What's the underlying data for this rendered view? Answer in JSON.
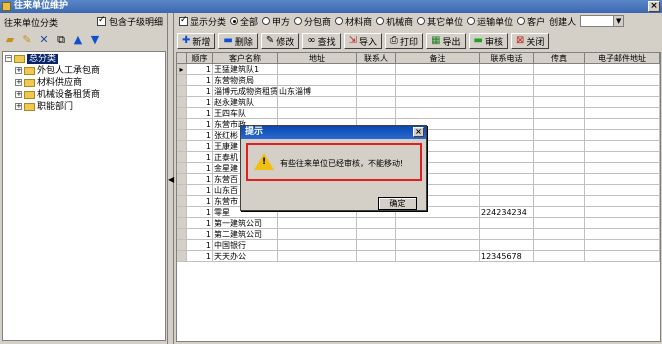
{
  "window": {
    "title": "往来单位维护",
    "close": "×"
  },
  "left": {
    "header": "往来单位分类",
    "include_sub": "包含子级明细",
    "tree": [
      {
        "label": "总分类",
        "selected": true
      },
      {
        "label": "外包人工承包商"
      },
      {
        "label": "材料供应商"
      },
      {
        "label": "机械设备租赁商"
      },
      {
        "label": "职能部门"
      }
    ]
  },
  "filter": {
    "show_category": "显示分类",
    "options": [
      "全部",
      "甲方",
      "分包商",
      "材料商",
      "机械商",
      "其它单位",
      "运输单位",
      "客户"
    ],
    "creator_label": "创建人",
    "creator_value": ""
  },
  "toolbar": {
    "new": "新增",
    "delete": "删除",
    "edit": "修改",
    "find": "查找",
    "import": "导入",
    "print": "打印",
    "export": "导出",
    "audit": "审核",
    "close": "关闭"
  },
  "grid": {
    "columns": [
      "顺序",
      "客户名称",
      "地址",
      "联系人",
      "备注",
      "联系电话",
      "传真",
      "电子邮件地址"
    ],
    "rows": [
      {
        "seq": "1",
        "name": "王猛建筑队1",
        "addr": "",
        "phone": ""
      },
      {
        "seq": "1",
        "name": "东营物资局",
        "addr": "",
        "phone": ""
      },
      {
        "seq": "1",
        "name": "淄博元成物资租赁",
        "addr": "山东淄博",
        "phone": ""
      },
      {
        "seq": "1",
        "name": "赵永建筑队",
        "addr": "",
        "phone": ""
      },
      {
        "seq": "1",
        "name": "王四车队",
        "addr": "",
        "phone": ""
      },
      {
        "seq": "1",
        "name": "东营市政",
        "addr": "",
        "phone": ""
      },
      {
        "seq": "1",
        "name": "张红彬",
        "addr": "",
        "phone": ""
      },
      {
        "seq": "1",
        "name": "王康建",
        "addr": "",
        "phone": ""
      },
      {
        "seq": "1",
        "name": "正泰机",
        "addr": "",
        "phone": ""
      },
      {
        "seq": "1",
        "name": "金星建",
        "addr": "",
        "phone": ""
      },
      {
        "seq": "1",
        "name": "东营百",
        "addr": "",
        "phone": ""
      },
      {
        "seq": "1",
        "name": "山东百",
        "addr": "",
        "phone": ""
      },
      {
        "seq": "1",
        "name": "东营市",
        "addr": "",
        "phone": ""
      },
      {
        "seq": "1",
        "name": "零星",
        "addr": "",
        "phone": "224234234"
      },
      {
        "seq": "1",
        "name": "第一建筑公司",
        "addr": "",
        "phone": ""
      },
      {
        "seq": "1",
        "name": "第二建筑公司",
        "addr": "",
        "phone": ""
      },
      {
        "seq": "1",
        "name": "中国银行",
        "addr": "",
        "phone": ""
      },
      {
        "seq": "1",
        "name": "天天办公",
        "addr": "",
        "phone": "12345678"
      }
    ]
  },
  "dialog": {
    "title": "提示",
    "close": "×",
    "icon": "warning-icon",
    "message": "有些往来单位已经审核，不能移动!",
    "ok": "确定"
  }
}
